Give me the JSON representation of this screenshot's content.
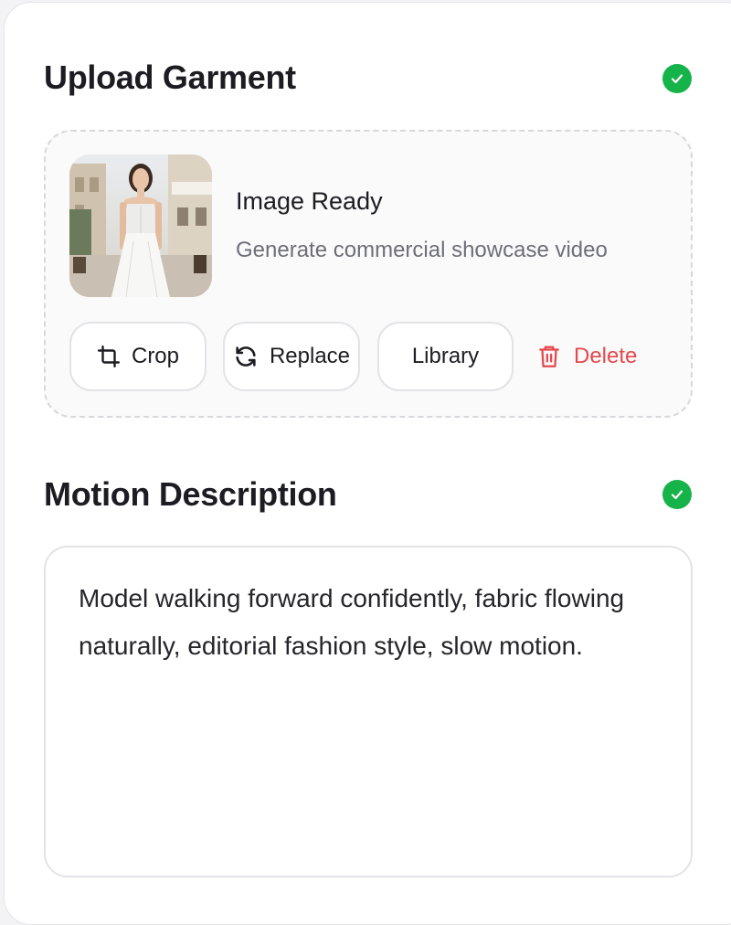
{
  "upload": {
    "title": "Upload Garment",
    "status_icon": "check-circle-icon",
    "image_status": "Image Ready",
    "image_hint": "Generate commercial showcase video",
    "thumbnail_alt": "Model in white dress",
    "actions": {
      "crop": "Crop",
      "replace": "Replace",
      "library": "Library",
      "delete": "Delete"
    }
  },
  "motion": {
    "title": "Motion Description",
    "status_icon": "check-circle-icon",
    "text": "Model walking forward confidently, fabric flowing naturally, editorial fashion style, slow motion."
  },
  "colors": {
    "success": "#16b34a",
    "danger": "#e5484d",
    "muted": "#6e6e78"
  }
}
